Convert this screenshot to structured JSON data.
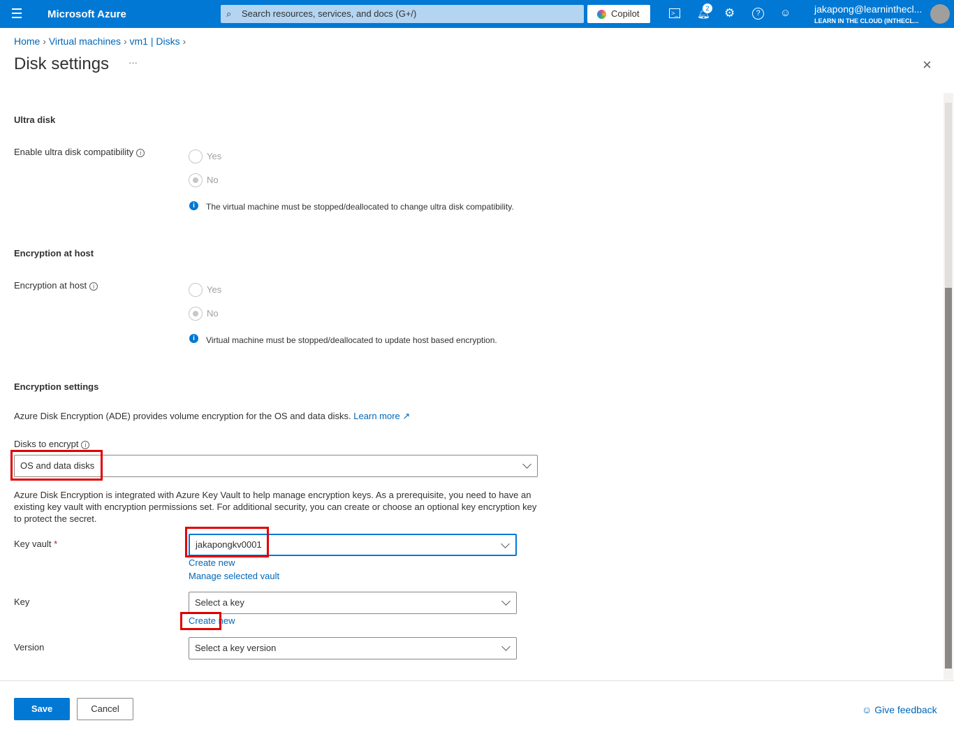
{
  "header": {
    "app_title": "Microsoft Azure",
    "search_placeholder": "Search resources, services, and docs (G+/)",
    "copilot": "Copilot",
    "notification_count": "2",
    "user_email": "jakapong@learninthecl...",
    "user_tenant": "LEARN IN THE CLOUD (INTHECL..."
  },
  "breadcrumb": [
    "Home",
    "Virtual machines",
    "vm1 | Disks"
  ],
  "page": {
    "title": "Disk settings",
    "more": "···"
  },
  "ultra": {
    "heading": "Ultra disk",
    "label": "Enable ultra disk compatibility",
    "yes": "Yes",
    "no": "No",
    "selected": "No",
    "info": "The virtual machine must be stopped/deallocated to change ultra disk compatibility."
  },
  "host": {
    "heading": "Encryption at host",
    "label": "Encryption at host",
    "yes": "Yes",
    "no": "No",
    "selected": "No",
    "info": "Virtual machine must be stopped/deallocated to update host based encryption."
  },
  "enc": {
    "heading": "Encryption settings",
    "desc": "Azure Disk Encryption (ADE) provides volume encryption for the OS and data disks.",
    "learn_more": "Learn more",
    "disks_label": "Disks to encrypt",
    "disks_value": "OS and data disks",
    "kv_desc": "Azure Disk Encryption is integrated with Azure Key Vault to help manage encryption keys. As a prerequisite, you need to have an existing key vault with encryption permissions set. For additional security, you can create or choose an optional key encryption key to protect the secret.",
    "kv_label": "Key vault",
    "required": "*",
    "kv_value": "jakapongkv0001",
    "kv_create": "Create new",
    "kv_manage": "Manage selected vault",
    "key_label": "Key",
    "key_placeholder": "Select a key",
    "key_create": "Create new",
    "version_label": "Version",
    "version_placeholder": "Select a key version"
  },
  "footer": {
    "save": "Save",
    "cancel": "Cancel",
    "feedback": "Give feedback"
  },
  "colors": {
    "brand": "#0078d4",
    "highlight": "#e00000"
  }
}
